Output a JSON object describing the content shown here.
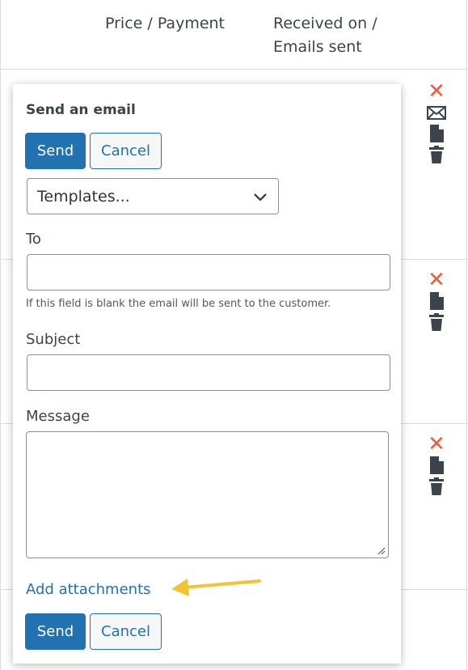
{
  "table": {
    "columns": [
      "Price / Payment",
      "Received on / Emails sent"
    ]
  },
  "row_actions": [
    {
      "icons": [
        "close-icon",
        "envelope-icon",
        "document-icon",
        "trash-icon"
      ]
    },
    {
      "icons": [
        "close-icon",
        "document-icon",
        "trash-icon"
      ]
    },
    {
      "icons": [
        "close-icon",
        "document-icon",
        "trash-icon"
      ]
    }
  ],
  "popup": {
    "title": "Send an email",
    "send_label": "Send",
    "cancel_label": "Cancel",
    "templates": {
      "selected": "Templates..."
    },
    "to": {
      "label": "To",
      "value": "",
      "hint": "If this field is blank the email will be sent to the customer."
    },
    "subject": {
      "label": "Subject",
      "value": ""
    },
    "message": {
      "label": "Message",
      "value": ""
    },
    "attachments_label": "Add attachments",
    "bottom_send_label": "Send",
    "bottom_cancel_label": "Cancel"
  },
  "colors": {
    "primary": "#2271b1",
    "delete_red": "#f05b3c",
    "annotation_arrow": "#f4c430"
  }
}
